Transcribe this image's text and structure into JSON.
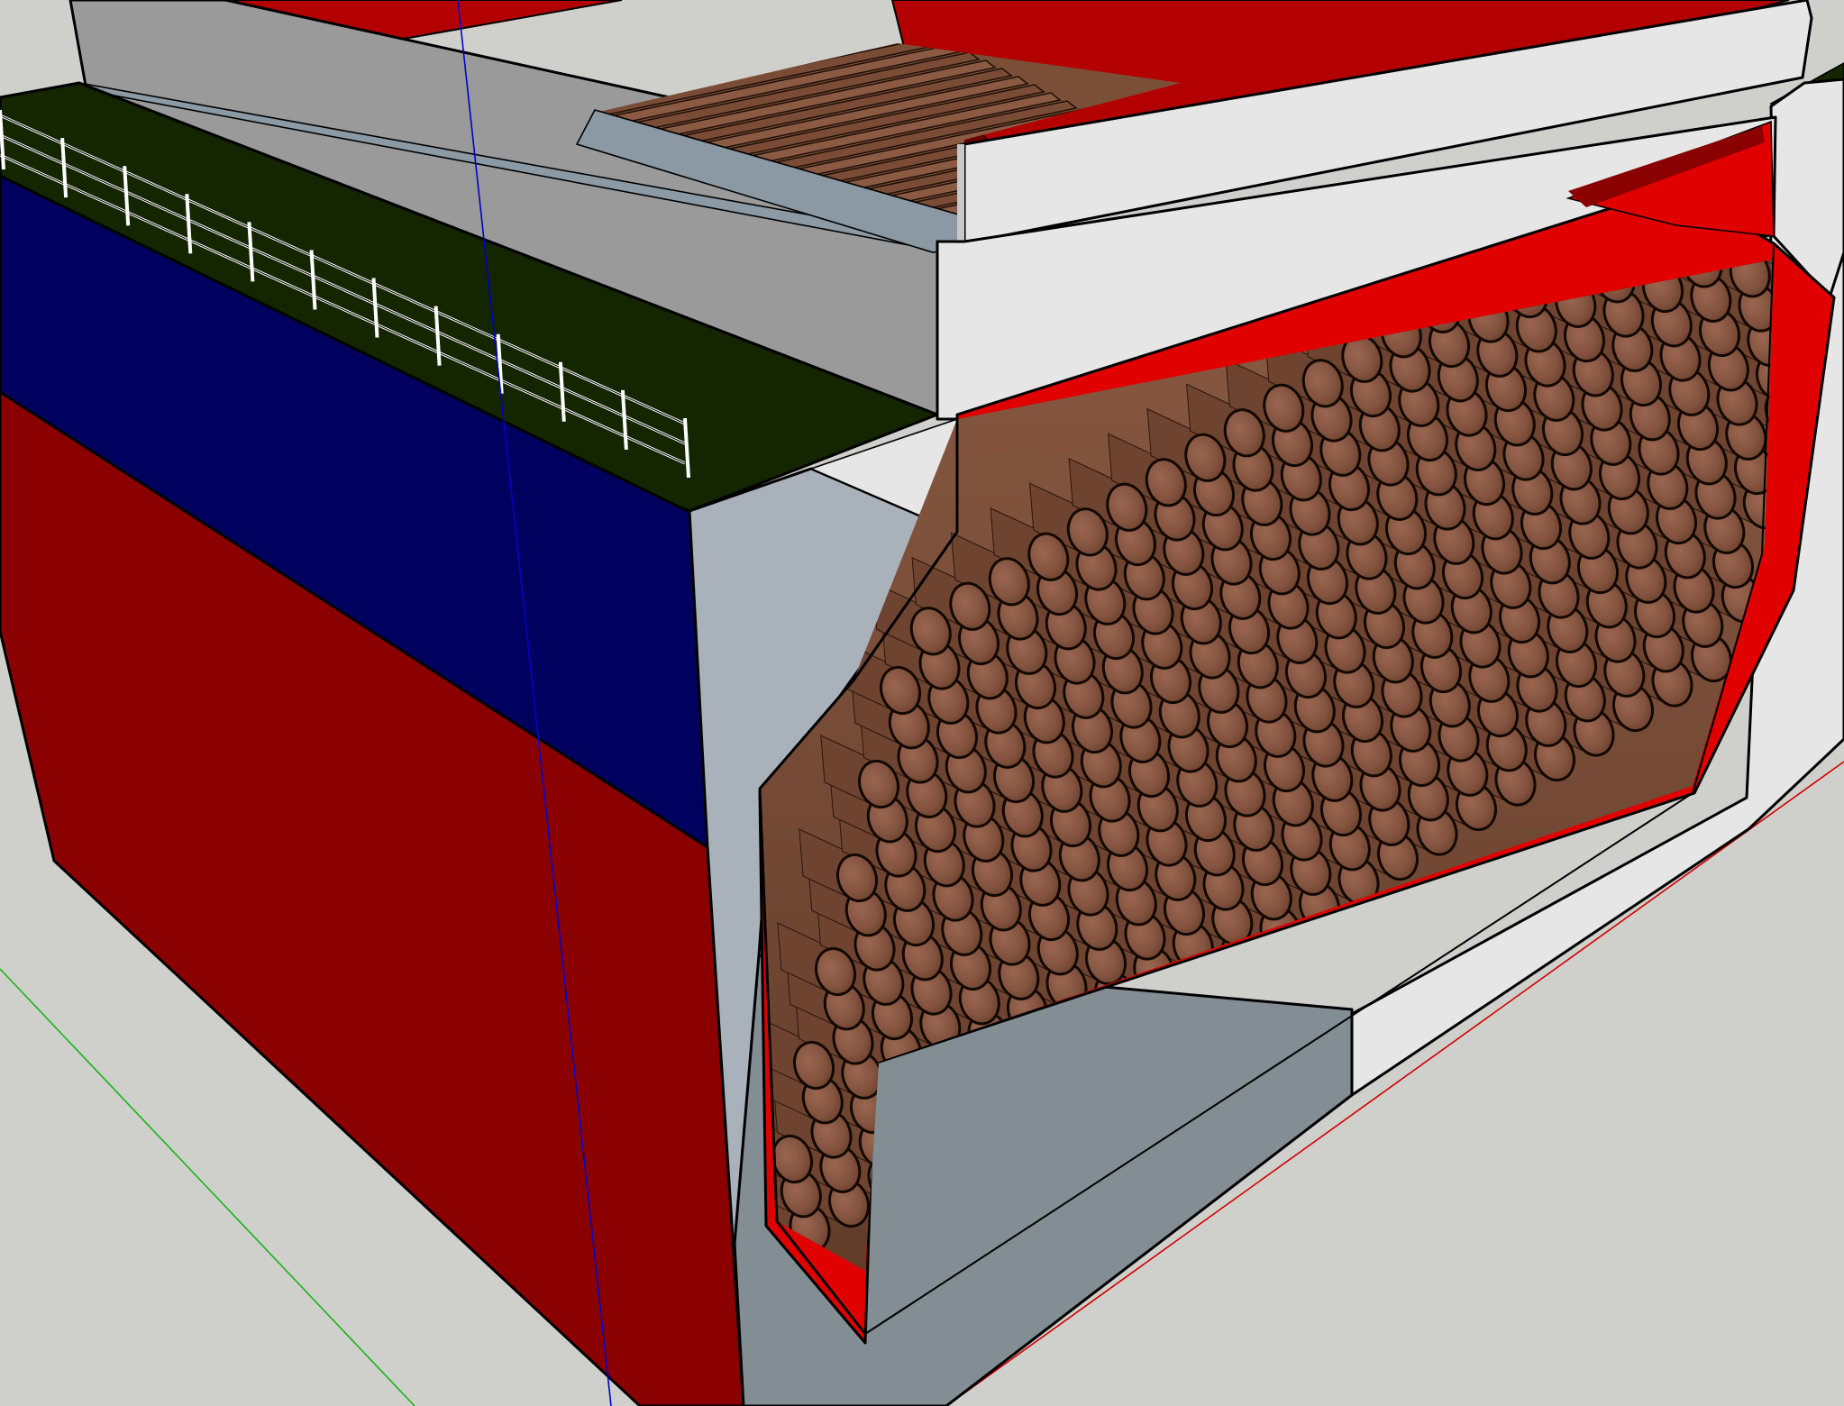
{
  "app": {
    "viewport_name": "sketch-3d-viewport"
  },
  "colors": {
    "background": "#cfd0cb",
    "hull_red": "#8a0000",
    "hull_blue": "#00005e",
    "deck_green": "#132600",
    "hold_red": "#e00000",
    "log_end": "#8d5b42",
    "log_side": "#7b4e37",
    "white_face": "#e6e6e6",
    "light_grey": "#a9b2ba",
    "mid_grey": "#828d94",
    "bulkhead_grey": "#9a9a9a",
    "axis_red": "#d10000",
    "axis_green": "#18b418",
    "axis_blue": "#0000cc"
  },
  "model": {
    "cargo": "log-stack",
    "log_rows": 14,
    "log_columns": 25
  },
  "axes": [
    {
      "name": "red-axis",
      "color": "#d10000"
    },
    {
      "name": "green-axis",
      "color": "#18b418"
    },
    {
      "name": "blue-axis",
      "color": "#0000cc"
    }
  ]
}
